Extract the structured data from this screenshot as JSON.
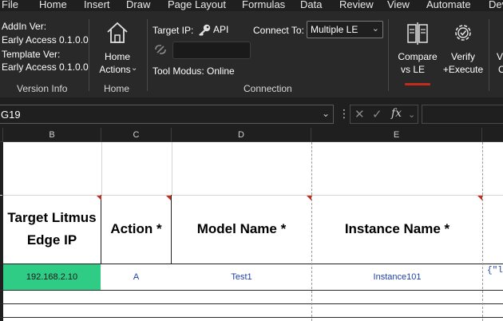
{
  "menu": [
    "File",
    "Home",
    "Insert",
    "Draw",
    "Page Layout",
    "Formulas",
    "Data",
    "Review",
    "View",
    "Automate",
    "Dev"
  ],
  "ribbon": {
    "version_info": {
      "addin_label": "AddIn Ver:",
      "addin_value": "Early Access 0.1.0.0",
      "template_label": "Template Ver:",
      "template_value": "Early Access 0.1.0.0",
      "group_label": "Version Info"
    },
    "home": {
      "button_line1": "Home",
      "button_line2": "Actions",
      "group_label": "Home"
    },
    "connection": {
      "target_ip_label": "Target IP:",
      "api_label": "API",
      "connect_to_label": "Connect To:",
      "connect_to_value": "Multiple LE",
      "ip_input_value": "",
      "tool_modus": "Tool Modus: Online",
      "group_label": "Connection"
    },
    "compare": {
      "line1": "Compare",
      "line2": "vs LE"
    },
    "verify": {
      "line1": "Verify",
      "line2": "+Execute"
    },
    "partial": {
      "line1": "V",
      "line2": "C"
    }
  },
  "formula_bar": {
    "name_box": "G19",
    "formula": ""
  },
  "sheet": {
    "columns": [
      "B",
      "C",
      "D",
      "E"
    ],
    "header_row": {
      "b": "Target Litmus Edge IP",
      "c": "Action *",
      "d": "Model Name *",
      "e": "Instance Name *"
    },
    "data_row": {
      "b": "192.168.2.10",
      "c": "A",
      "d": "Test1",
      "e": "Instance101",
      "f": "{\"lit"
    }
  },
  "colors": {
    "accent_red": "#c42b1c",
    "ip_cell_fill": "#2ecc85",
    "data_text": "#1e3fa8"
  }
}
